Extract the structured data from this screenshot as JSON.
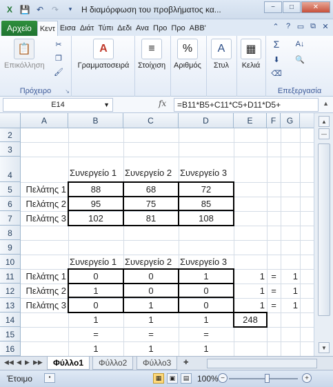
{
  "window": {
    "title": "Η διαμόρφωση του προβλήματος κα...",
    "buttons": {
      "minimize": "−",
      "restore": "□",
      "close": "✕"
    }
  },
  "qat": {
    "save_icon": "save-icon",
    "undo_icon": "undo-icon",
    "redo_icon": "redo-icon"
  },
  "ribbon": {
    "file_tab": "Αρχείο",
    "tabs": [
      "Κεντ",
      "Εισα",
      "Διάτ",
      "Τύπι",
      "Δεδι",
      "Ανα",
      "Προ",
      "Προ",
      "ABB'"
    ],
    "active_tab": "Κεντ",
    "groups": {
      "clipboard": {
        "label": "Πρόχειρο",
        "paste": "Επικόλληση"
      },
      "font": {
        "label": "Γραμματοσειρά"
      },
      "alignment": {
        "label": "Στοίχιση"
      },
      "number": {
        "label": "Αριθμός"
      },
      "styles": {
        "label": "Στυλ"
      },
      "cells": {
        "label": "Κελιά"
      },
      "editing": {
        "label": "Επεξεργασία"
      }
    }
  },
  "formula_bar": {
    "name_box": "E14",
    "fx": "fx",
    "formula": "=B11*B5+C11*C5+D11*D5+"
  },
  "grid": {
    "columns": [
      "A",
      "B",
      "C",
      "D",
      "E",
      "F",
      "G"
    ],
    "rows": [
      "2",
      "3",
      "4",
      "5",
      "6",
      "7",
      "8",
      "9",
      "10",
      "11",
      "12",
      "13",
      "14",
      "15",
      "16"
    ],
    "header1": {
      "b": "Συνεργείο 1",
      "c": "Συνεργείο 2",
      "d": "Συνεργείο 3"
    },
    "cost_rows": [
      {
        "a": "Πελάτης 1",
        "b": "88",
        "c": "68",
        "d": "72"
      },
      {
        "a": "Πελάτης 2",
        "b": "95",
        "c": "75",
        "d": "85"
      },
      {
        "a": "Πελάτης 3",
        "b": "102",
        "c": "81",
        "d": "108"
      }
    ],
    "header2": {
      "b": "Συνεργείο 1",
      "c": "Συνεργείο 2",
      "d": "Συνεργείο 3"
    },
    "assign_rows": [
      {
        "a": "Πελάτης 1",
        "b": "0",
        "c": "0",
        "d": "1",
        "e": "1",
        "f": "=",
        "g": "1"
      },
      {
        "a": "Πελάτης 2",
        "b": "1",
        "c": "0",
        "d": "0",
        "e": "1",
        "f": "=",
        "g": "1"
      },
      {
        "a": "Πελάτης 3",
        "b": "0",
        "c": "1",
        "d": "0",
        "e": "1",
        "f": "=",
        "g": "1"
      }
    ],
    "row14": {
      "b": "1",
      "c": "1",
      "d": "1",
      "e": "248"
    },
    "row15": {
      "b": "=",
      "c": "=",
      "d": "="
    },
    "row16": {
      "b": "1",
      "c": "1",
      "d": "1"
    }
  },
  "sheets": {
    "tabs": [
      "Φύλλο1",
      "Φύλλο2",
      "Φύλλο3"
    ],
    "active": "Φύλλο1"
  },
  "status": {
    "ready": "Έτοιμο",
    "zoom": "100%"
  }
}
